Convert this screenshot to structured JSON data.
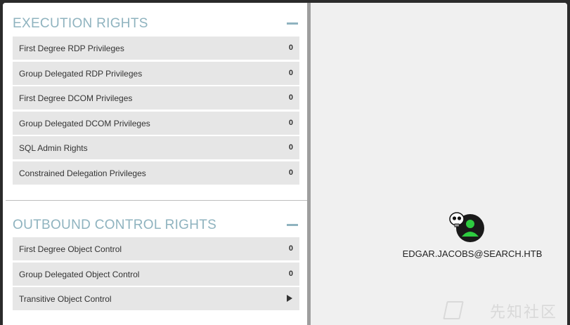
{
  "sections": [
    {
      "title": "EXECUTION RIGHTS",
      "rows": [
        {
          "label": "First Degree RDP Privileges",
          "count": "0"
        },
        {
          "label": "Group Delegated RDP Privileges",
          "count": "0"
        },
        {
          "label": "First Degree DCOM Privileges",
          "count": "0"
        },
        {
          "label": "Group Delegated DCOM Privileges",
          "count": "0"
        },
        {
          "label": "SQL Admin Rights",
          "count": "0"
        },
        {
          "label": "Constrained Delegation Privileges",
          "count": "0"
        }
      ]
    },
    {
      "title": "OUTBOUND CONTROL RIGHTS",
      "rows": [
        {
          "label": "First Degree Object Control",
          "count": "0"
        },
        {
          "label": "Group Delegated Object Control",
          "count": "0"
        },
        {
          "label": "Transitive Object Control"
        }
      ]
    }
  ],
  "graph": {
    "node_label": "EDGAR.JACOBS@SEARCH.HTB",
    "node_icon": "pwned-user-icon",
    "node_color": "#2ecc40"
  },
  "watermark": {
    "text": "先知社区"
  }
}
